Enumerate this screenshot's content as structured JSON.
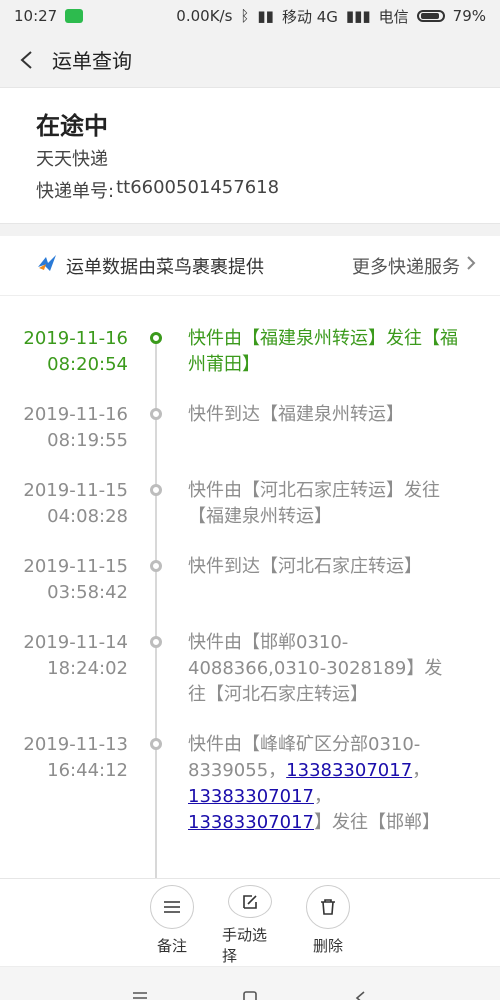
{
  "statusbar": {
    "time": "10:27",
    "network_speed": "0.00K/s",
    "carrier1": "移动 4G",
    "carrier2": "电信",
    "battery": "79%",
    "icons": [
      "wechat-icon",
      "bluetooth-icon",
      "signal-icon",
      "battery-icon"
    ]
  },
  "header": {
    "title": "运单查询",
    "back_icon": "chevron-left-icon"
  },
  "shipment": {
    "status": "在途中",
    "company": "天天快递",
    "waybill_label": "快递单号:",
    "waybill_number": "tt6600501457618"
  },
  "provider": {
    "text": "运单数据由菜鸟裹裹提供",
    "more": "更多快递服务"
  },
  "timeline": [
    {
      "date": "2019-11-16",
      "time": "08:20:54",
      "text": "快件由【福建泉州转运】发往【福州莆田】",
      "active": true
    },
    {
      "date": "2019-11-16",
      "time": "08:19:55",
      "text": "快件到达【福建泉州转运】",
      "active": false
    },
    {
      "date": "2019-11-15",
      "time": "04:08:28",
      "text": "快件由【河北石家庄转运】发往【福建泉州转运】",
      "active": false
    },
    {
      "date": "2019-11-15",
      "time": "03:58:42",
      "text": "快件到达【河北石家庄转运】",
      "active": false
    },
    {
      "date": "2019-11-14",
      "time": "18:24:02",
      "text": "快件由【邯郸0310-4088366,0310-3028189】发往【河北石家庄转运】",
      "active": false
    },
    {
      "date": "2019-11-13",
      "time": "16:44:12",
      "text_prefix": "快件由【峰峰矿区分部0310-8339055，",
      "phone1": "13383307017",
      "sep1": "，",
      "phone2": "13383307017",
      "sep2": "，",
      "phone3": "13383307017",
      "text_suffix": "】发往【邯郸】",
      "active": false
    }
  ],
  "actions": [
    {
      "label": "备注",
      "icon": "note-icon"
    },
    {
      "label": "手动选择",
      "icon": "edit-icon"
    },
    {
      "label": "删除",
      "icon": "trash-icon"
    }
  ],
  "navbar": {
    "icons": [
      "menu-icon",
      "home-icon",
      "back-icon"
    ]
  },
  "colors": {
    "accent_green": "#3b9a1c",
    "link_blue": "#1a0dab",
    "muted_text": "#8d8d8d"
  }
}
